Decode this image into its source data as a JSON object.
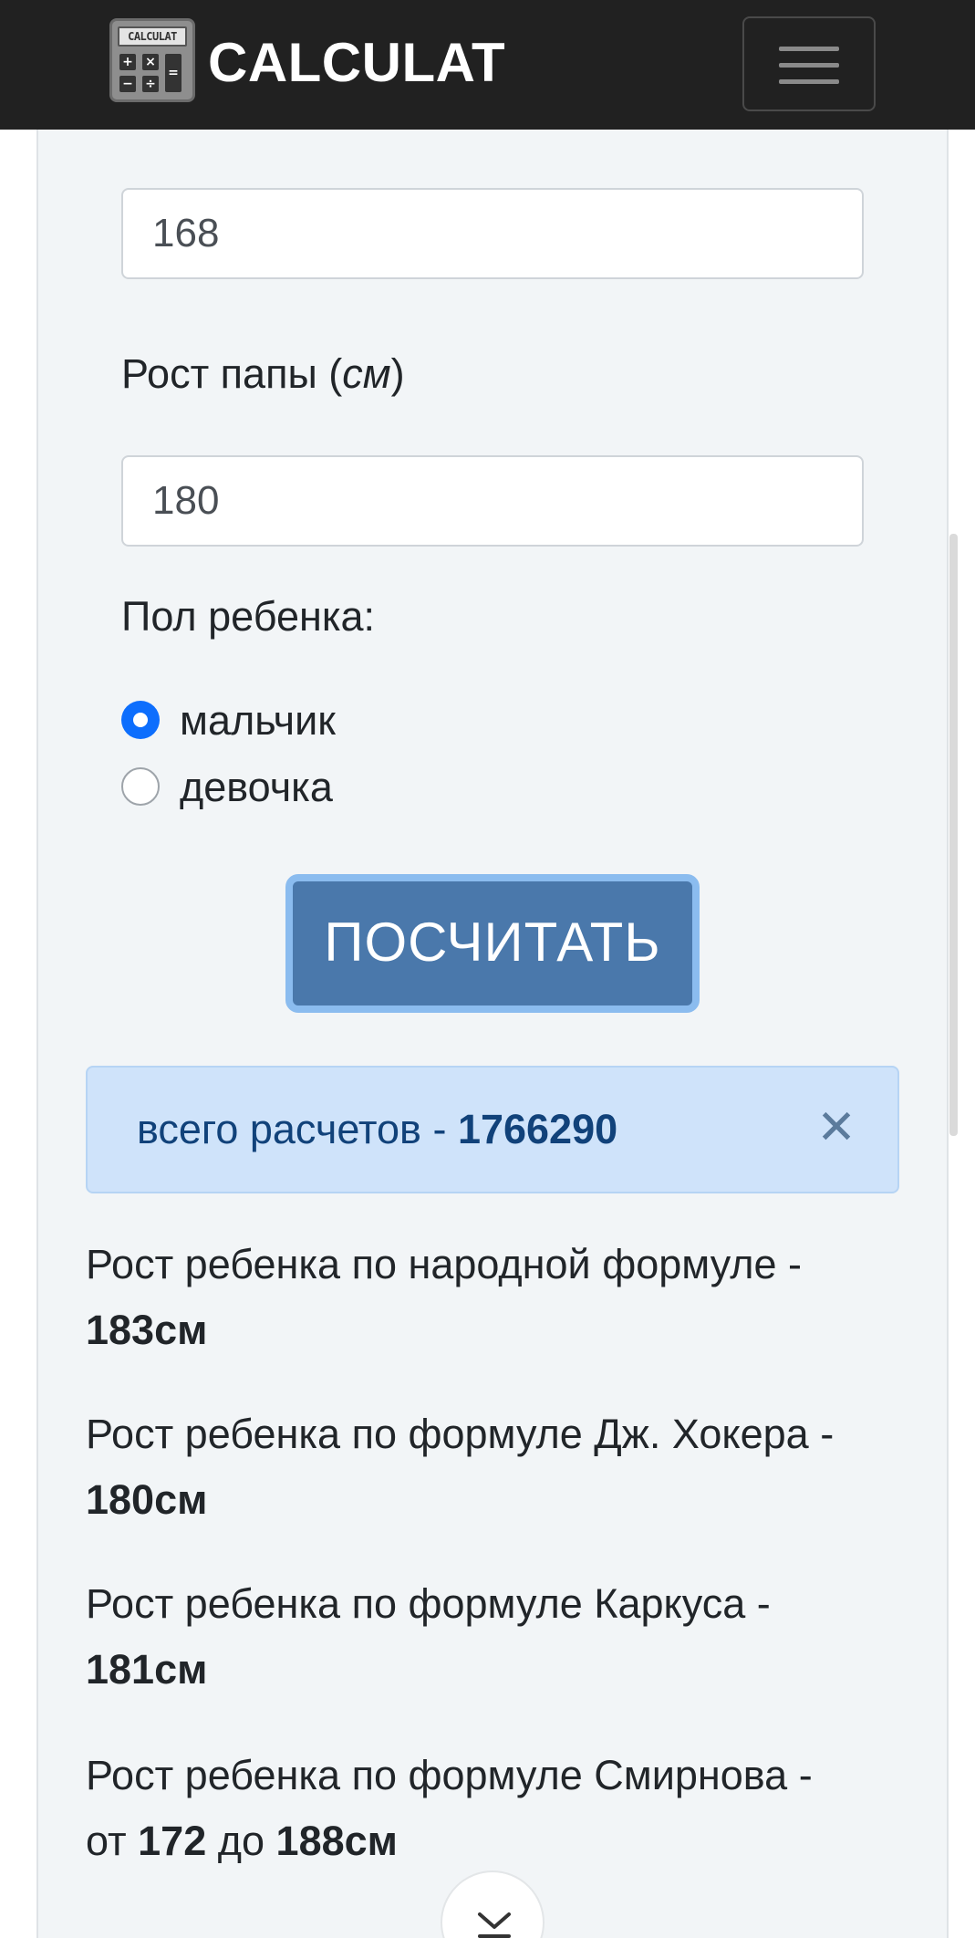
{
  "header": {
    "logo_screen_text": "CALCULAT",
    "brand": "CALCULAT",
    "menu_icon": "hamburger-menu-icon"
  },
  "form": {
    "mother_height_value": "168",
    "father_label_text": "Рост папы (",
    "father_label_unit": "см",
    "father_label_close": ")",
    "father_height_value": "180",
    "gender_label": "Пол ребенка:",
    "gender_options": [
      {
        "label": "мальчик",
        "checked": true
      },
      {
        "label": "девочка",
        "checked": false
      }
    ],
    "submit_label": "ПОСЧИТАТЬ"
  },
  "alert": {
    "text": "всего расчетов - ",
    "count": "1766290",
    "close_symbol": "✕"
  },
  "results": [
    {
      "text": "Рост ребенка по народной формуле -",
      "value": "183см"
    },
    {
      "text": "Рост ребенка по формуле Дж. Хокера -",
      "value": "180см"
    },
    {
      "text": "Рост ребенка по формуле Каркуса -",
      "value": "181см"
    }
  ],
  "smirnov": {
    "text": "Рост ребенка по формуле Смирнова -",
    "from_word": "от ",
    "from_value": "172",
    "to_word": " до ",
    "to_value": "188см"
  },
  "colors": {
    "header_bg": "#212121",
    "button_bg": "#4a78ab",
    "radio_checked": "#0d6efd",
    "alert_bg": "#cfe3fa",
    "alert_text": "#11427a"
  }
}
